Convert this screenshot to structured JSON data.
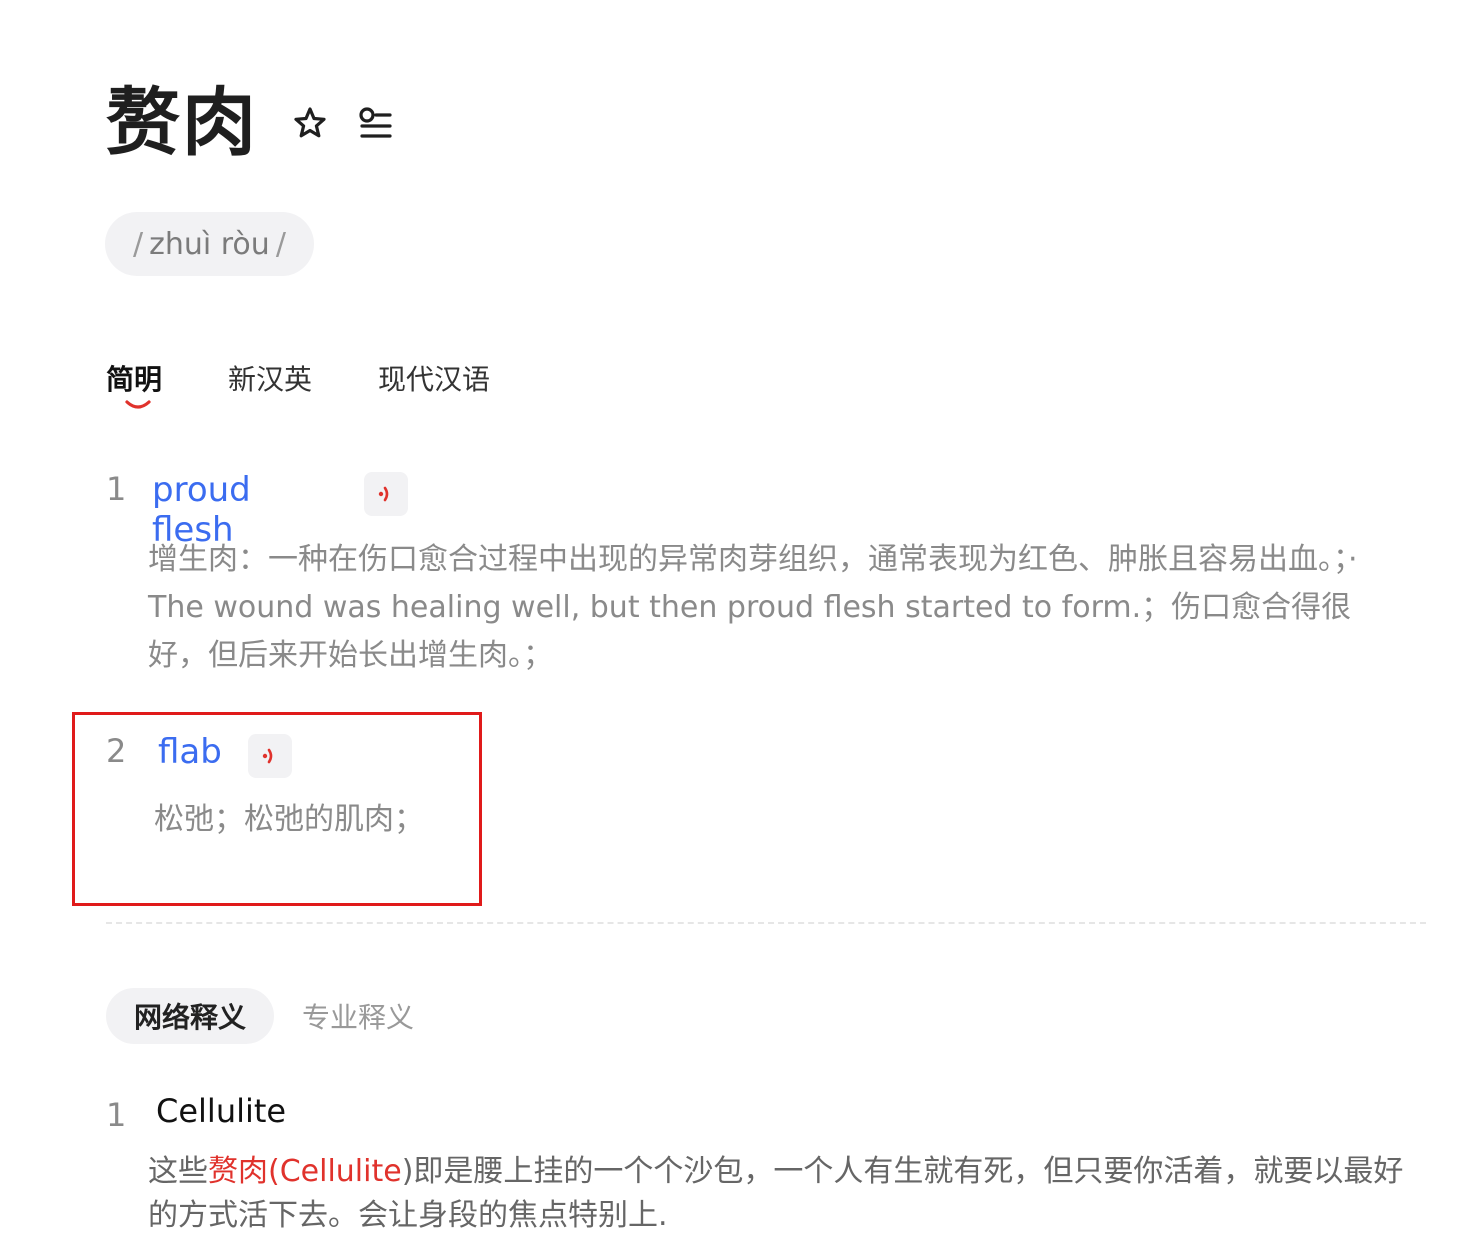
{
  "headword": {
    "text": "赘肉",
    "favorite_icon": "star-outline-icon",
    "wordlist_icon": "list-add-icon"
  },
  "pinyin": {
    "text": "zhuì ròu",
    "slash": "/"
  },
  "dict_tabs": [
    {
      "label": "简明",
      "active": true
    },
    {
      "label": "新汉英",
      "active": false
    },
    {
      "label": "现代汉语",
      "active": false
    }
  ],
  "definitions": [
    {
      "num": "1",
      "word": "proud flesh",
      "desc": "增生肉：一种在伤口愈合过程中出现的异常肉芽组织，通常表现为红色、肿胀且容易出血。；· The wound was healing well, but then proud flesh started to form.；伤口愈合得很好，但后来开始长出增生肉。；"
    },
    {
      "num": "2",
      "word": "flab",
      "desc": "松弛；松弛的肌肉；"
    }
  ],
  "web_tabs": [
    {
      "label": "网络释义",
      "active": true
    },
    {
      "label": "专业释义",
      "active": false
    }
  ],
  "web_definitions": [
    {
      "num": "1",
      "term": "Cellulite",
      "desc_prefix": "这些",
      "desc_hl_word": "赘肉",
      "desc_hl_paren": "(Cellulite",
      "desc_rest": ")即是腰上挂的一个个沙包，一个人有生就有死，但只要你活着，就要以最好的方式活下去。会让身段的焦点特别上."
    }
  ],
  "colors": {
    "link_blue": "#3b6cf0",
    "accent_red": "#e0322c",
    "highlight_box": "#e01a1a"
  }
}
